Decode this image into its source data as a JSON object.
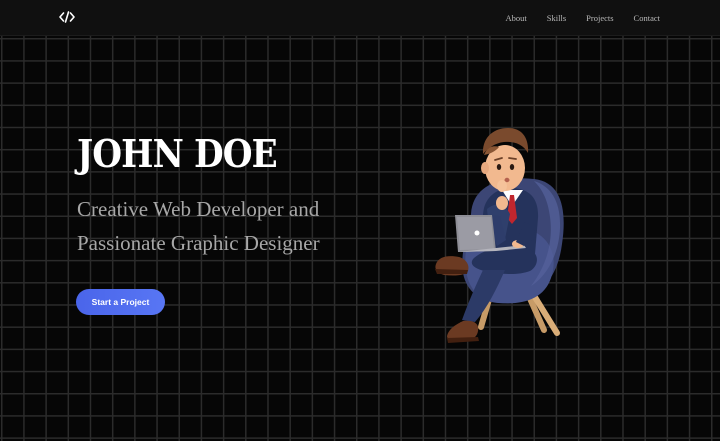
{
  "nav": {
    "links": [
      "About",
      "Skills",
      "Projects",
      "Contact"
    ]
  },
  "hero": {
    "title": "JOHN DOE",
    "subtitle_line1": "Creative Web Developer and",
    "subtitle_line2": "Passionate Graphic Designer",
    "cta_label": "Start a Project"
  },
  "colors": {
    "background": "#070707",
    "navbar": "#101010",
    "grid_line": "#2b2b2b",
    "cta": "#5470f0",
    "title": "#ffffff",
    "subtitle": "#a7a7a7"
  },
  "icons": {
    "logo": "code-brackets-icon"
  }
}
